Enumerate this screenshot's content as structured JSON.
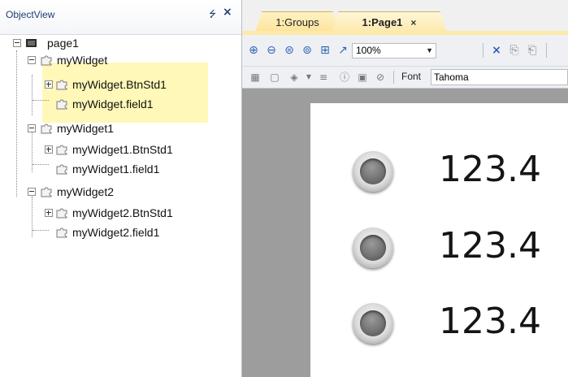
{
  "object_view": {
    "title": "ObjectView",
    "pin_icon": "pin-icon",
    "close_icon": "close-icon",
    "tree": [
      {
        "label": "page1",
        "icon": "page-icon"
      },
      {
        "label": "myWidget",
        "icon": "widget-icon",
        "highlighted": true
      },
      {
        "label": "myWidget.BtnStd1",
        "icon": "widget-icon",
        "highlighted": true
      },
      {
        "label": "myWidget.field1",
        "icon": "widget-icon",
        "highlighted": true
      },
      {
        "label": "myWidget1",
        "icon": "widget-icon"
      },
      {
        "label": "myWidget1.BtnStd1",
        "icon": "widget-icon"
      },
      {
        "label": "myWidget1.field1",
        "icon": "widget-icon"
      },
      {
        "label": "myWidget2",
        "icon": "widget-icon"
      },
      {
        "label": "myWidget2.BtnStd1",
        "icon": "widget-icon"
      },
      {
        "label": "myWidget2.field1",
        "icon": "widget-icon"
      }
    ]
  },
  "tabs": [
    {
      "label": "1:Groups",
      "active": false
    },
    {
      "label": "1:Page1",
      "active": true,
      "close": "×"
    }
  ],
  "toolbar": {
    "icons": [
      "zoom-in-icon",
      "zoom-out-icon",
      "zoom-page-icon",
      "zoom-fit-icon",
      "zoom-area-icon",
      "zoom-select-icon",
      "delete-icon",
      "copy-icon",
      "paste-icon"
    ],
    "zoom_value": "100%",
    "font_label": "Font",
    "font_value": "Tahoma"
  },
  "canvas": {
    "widgets": [
      {
        "value": "123.4"
      },
      {
        "value": "123.4"
      },
      {
        "value": "123.4"
      }
    ]
  },
  "colors": {
    "highlight": "#fff8b8",
    "tab_active": "#fde9ae",
    "canvas_background": "#9d9d9d",
    "title_text": "#1e3d73"
  }
}
